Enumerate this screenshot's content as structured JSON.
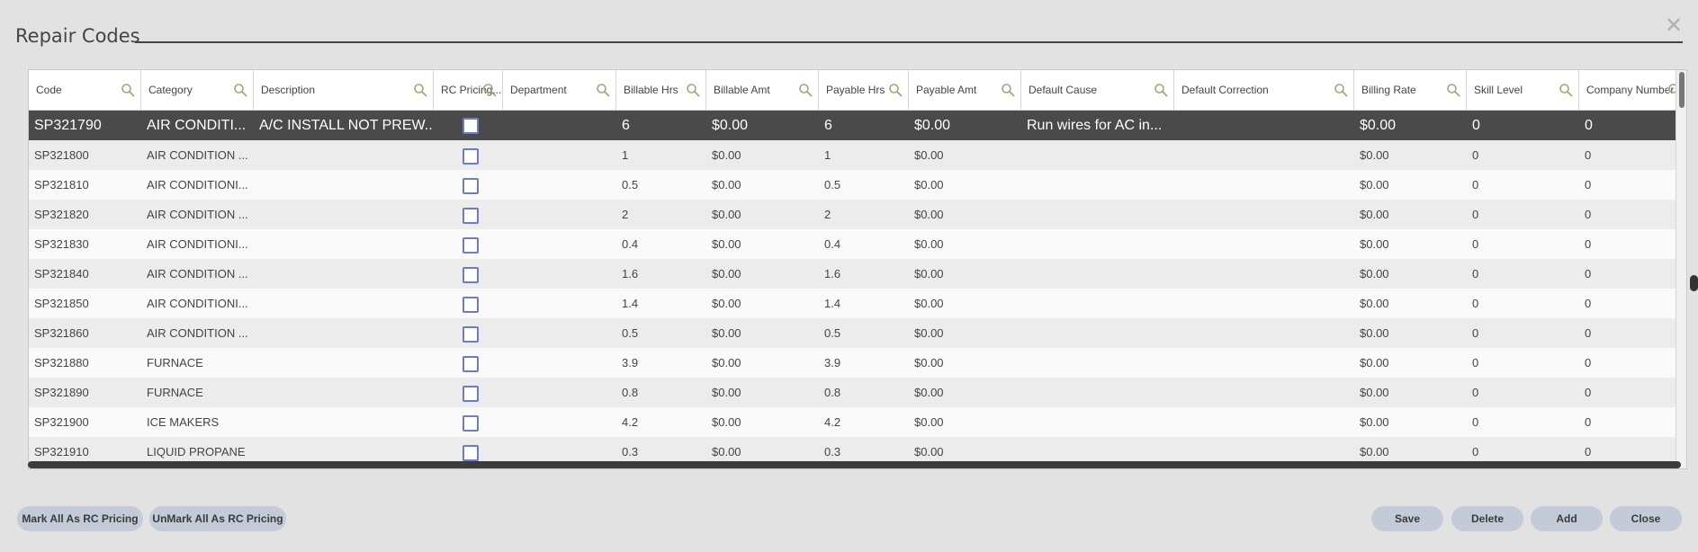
{
  "dialog": {
    "title": "Repair Codes",
    "close_glyph": "✕"
  },
  "columns": [
    {
      "label": "Code",
      "icon": "search-icon"
    },
    {
      "label": "Category",
      "icon": "search-icon"
    },
    {
      "label": "Description",
      "icon": "search-icon"
    },
    {
      "label": "RC Pricing...",
      "icon": "search-icon"
    },
    {
      "label": "Department",
      "icon": "search-icon"
    },
    {
      "label": "Billable Hrs",
      "icon": "search-icon"
    },
    {
      "label": "Billable Amt",
      "icon": "search-icon"
    },
    {
      "label": "Payable Hrs",
      "icon": "search-icon"
    },
    {
      "label": "Payable Amt",
      "icon": "search-icon"
    },
    {
      "label": "Default Cause",
      "icon": "search-icon"
    },
    {
      "label": "Default Correction",
      "icon": "search-icon"
    },
    {
      "label": "Billing Rate",
      "icon": "search-icon"
    },
    {
      "label": "Skill Level",
      "icon": "search-icon"
    },
    {
      "label": "Company Number",
      "icon": "search-icon"
    }
  ],
  "rows": [
    {
      "code": "SP321790",
      "category": "AIR CONDITI...",
      "description": "A/C INSTALL NOT PREW...",
      "rc_pricing": false,
      "department": "",
      "billable_hrs": "6",
      "billable_amt": "$0.00",
      "payable_hrs": "6",
      "payable_amt": "$0.00",
      "default_cause": "Run wires for AC in...",
      "default_correction": "",
      "billing_rate": "$0.00",
      "skill_level": "0",
      "company_number": "0",
      "selected": true
    },
    {
      "code": "SP321800",
      "category": "AIR CONDITION ...",
      "description": "",
      "rc_pricing": false,
      "department": "",
      "billable_hrs": "1",
      "billable_amt": "$0.00",
      "payable_hrs": "1",
      "payable_amt": "$0.00",
      "default_cause": "",
      "default_correction": "",
      "billing_rate": "$0.00",
      "skill_level": "0",
      "company_number": "0"
    },
    {
      "code": "SP321810",
      "category": "AIR CONDITIONI...",
      "description": "",
      "rc_pricing": false,
      "department": "",
      "billable_hrs": "0.5",
      "billable_amt": "$0.00",
      "payable_hrs": "0.5",
      "payable_amt": "$0.00",
      "default_cause": "",
      "default_correction": "",
      "billing_rate": "$0.00",
      "skill_level": "0",
      "company_number": "0"
    },
    {
      "code": "SP321820",
      "category": "AIR CONDITION ...",
      "description": "",
      "rc_pricing": false,
      "department": "",
      "billable_hrs": "2",
      "billable_amt": "$0.00",
      "payable_hrs": "2",
      "payable_amt": "$0.00",
      "default_cause": "",
      "default_correction": "",
      "billing_rate": "$0.00",
      "skill_level": "0",
      "company_number": "0"
    },
    {
      "code": "SP321830",
      "category": "AIR CONDITIONI...",
      "description": "",
      "rc_pricing": false,
      "department": "",
      "billable_hrs": "0.4",
      "billable_amt": "$0.00",
      "payable_hrs": "0.4",
      "payable_amt": "$0.00",
      "default_cause": "",
      "default_correction": "",
      "billing_rate": "$0.00",
      "skill_level": "0",
      "company_number": "0"
    },
    {
      "code": "SP321840",
      "category": "AIR CONDITION ...",
      "description": "",
      "rc_pricing": false,
      "department": "",
      "billable_hrs": "1.6",
      "billable_amt": "$0.00",
      "payable_hrs": "1.6",
      "payable_amt": "$0.00",
      "default_cause": "",
      "default_correction": "",
      "billing_rate": "$0.00",
      "skill_level": "0",
      "company_number": "0"
    },
    {
      "code": "SP321850",
      "category": "AIR CONDITIONI...",
      "description": "",
      "rc_pricing": false,
      "department": "",
      "billable_hrs": "1.4",
      "billable_amt": "$0.00",
      "payable_hrs": "1.4",
      "payable_amt": "$0.00",
      "default_cause": "",
      "default_correction": "",
      "billing_rate": "$0.00",
      "skill_level": "0",
      "company_number": "0"
    },
    {
      "code": "SP321860",
      "category": "AIR CONDITION ...",
      "description": "",
      "rc_pricing": false,
      "department": "",
      "billable_hrs": "0.5",
      "billable_amt": "$0.00",
      "payable_hrs": "0.5",
      "payable_amt": "$0.00",
      "default_cause": "",
      "default_correction": "",
      "billing_rate": "$0.00",
      "skill_level": "0",
      "company_number": "0"
    },
    {
      "code": "SP321880",
      "category": "FURNACE",
      "description": "",
      "rc_pricing": false,
      "department": "",
      "billable_hrs": "3.9",
      "billable_amt": "$0.00",
      "payable_hrs": "3.9",
      "payable_amt": "$0.00",
      "default_cause": "",
      "default_correction": "",
      "billing_rate": "$0.00",
      "skill_level": "0",
      "company_number": "0"
    },
    {
      "code": "SP321890",
      "category": "FURNACE",
      "description": "",
      "rc_pricing": false,
      "department": "",
      "billable_hrs": "0.8",
      "billable_amt": "$0.00",
      "payable_hrs": "0.8",
      "payable_amt": "$0.00",
      "default_cause": "",
      "default_correction": "",
      "billing_rate": "$0.00",
      "skill_level": "0",
      "company_number": "0"
    },
    {
      "code": "SP321900",
      "category": "ICE MAKERS",
      "description": "",
      "rc_pricing": false,
      "department": "",
      "billable_hrs": "4.2",
      "billable_amt": "$0.00",
      "payable_hrs": "4.2",
      "payable_amt": "$0.00",
      "default_cause": "",
      "default_correction": "",
      "billing_rate": "$0.00",
      "skill_level": "0",
      "company_number": "0"
    },
    {
      "code": "SP321910",
      "category": "LIQUID PROPANE",
      "description": "",
      "rc_pricing": false,
      "department": "",
      "billable_hrs": "0.3",
      "billable_amt": "$0.00",
      "payable_hrs": "0.3",
      "payable_amt": "$0.00",
      "default_cause": "",
      "default_correction": "",
      "billing_rate": "$0.00",
      "skill_level": "0",
      "company_number": "0"
    }
  ],
  "footer": {
    "mark_all": "Mark All As RC Pricing",
    "unmark_all": "UnMark All As RC Pricing",
    "save": "Save",
    "delete": "Delete",
    "add": "Add",
    "close": "Close"
  },
  "colors": {
    "selected_row": "#4a4a4a",
    "checkbox_border": "#6c7cc9",
    "button_bg": "#c3cbd8",
    "search_icon": "#a8a37a"
  }
}
